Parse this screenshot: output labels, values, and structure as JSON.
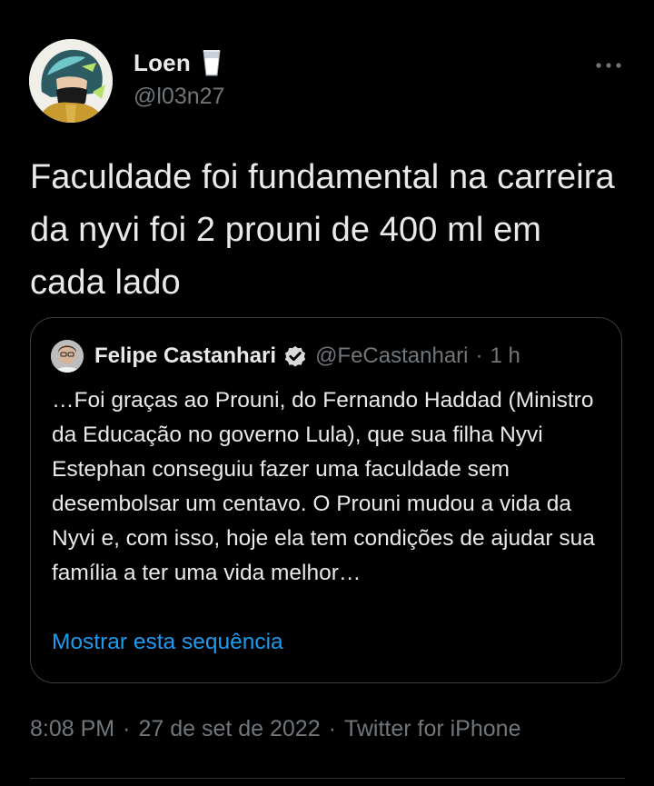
{
  "author": {
    "name": "Loen",
    "emoji": "milk-glass",
    "handle": "@l03n27"
  },
  "more_menu": "more-options-icon",
  "tweet": {
    "text": "Faculdade foi fundamental na carreira da nyvi foi 2 prouni de 400 ml em cada lado"
  },
  "quoted": {
    "name": "Felipe Castanhari",
    "verified": true,
    "handle": "@FeCastanhari",
    "dot": "·",
    "time": "1 h",
    "text": "…Foi graças ao Prouni, do Fernando Haddad (Ministro da Educação no governo Lula), que sua filha Nyvi Estephan conseguiu fazer uma faculdade sem desembolsar um centavo. O Prouni mudou a vida da Nyvi e, com isso, hoje ela tem condições de ajudar sua família a ter uma vida melhor…",
    "show_thread": "Mostrar esta sequência"
  },
  "meta": {
    "time": "8:08 PM",
    "sep1": "·",
    "date": "27 de set de 2022",
    "sep2": "·",
    "source": "Twitter for iPhone"
  },
  "colors": {
    "background": "#000000",
    "text": "#e7e9ea",
    "secondary": "#71767b",
    "link": "#1d9bf0",
    "border": "#3a3d41"
  }
}
